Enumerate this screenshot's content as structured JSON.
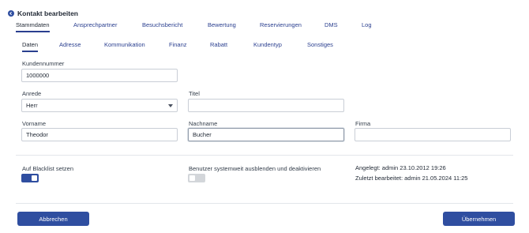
{
  "header": {
    "title": "Kontakt bearbeiten",
    "back_icon": "arrow-left-circle-icon"
  },
  "tabs": [
    "Stammdaten",
    "Ansprechpartner",
    "Besuchsbericht",
    "Bewertung",
    "Reservierungen",
    "DMS",
    "Log"
  ],
  "subtabs": [
    "Daten",
    "Adresse",
    "Kommunikation",
    "Finanz",
    "Rabatt",
    "Kundentyp",
    "Sonstiges"
  ],
  "form": {
    "kundennummer": {
      "label": "Kundennummer",
      "value": "1000000"
    },
    "anrede": {
      "label": "Anrede",
      "value": "Herr"
    },
    "titel": {
      "label": "Titel",
      "value": ""
    },
    "vorname": {
      "label": "Vorname",
      "value": "Theodor"
    },
    "nachname": {
      "label": "Nachname",
      "value": "Bucher"
    },
    "firma": {
      "label": "Firma",
      "value": ""
    }
  },
  "toggles": {
    "blacklist": {
      "label": "Auf Blacklist setzen",
      "on": true
    },
    "hide_user": {
      "label": "Benutzer systemweit ausblenden und deaktivieren",
      "on": false
    }
  },
  "meta": {
    "created": "Angelegt: admin 23.10.2012 19:26",
    "modified": "Zuletzt bearbeitet: admin 21.05.2024 11:25"
  },
  "buttons": {
    "cancel": "Abbrechen",
    "save": "Übernehmen"
  },
  "colors": {
    "accent": "#2f4ea0",
    "tab_text": "#2a3f8f",
    "toggle_off": "#d3d6da"
  }
}
